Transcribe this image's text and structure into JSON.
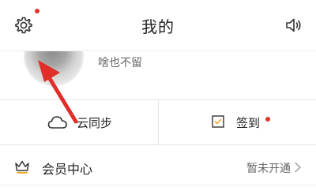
{
  "header": {
    "title": "我的",
    "settings_icon": "gear-icon",
    "sound_icon": "speaker-icon",
    "notification_dot_color": "#e5332a"
  },
  "profile": {
    "nickname": "啥也不留"
  },
  "actions": {
    "sync_label": "云同步",
    "sync_icon": "cloud-icon",
    "checkin_label": "签到",
    "checkin_icon": "checkbox-icon",
    "checkin_dot_color": "#e5332a"
  },
  "vip": {
    "icon": "crown-icon",
    "label": "会员中心",
    "status": "暂未开通",
    "chevron_icon": "chevron-right-icon"
  },
  "annotation": {
    "arrow_color": "#e02f2a"
  }
}
